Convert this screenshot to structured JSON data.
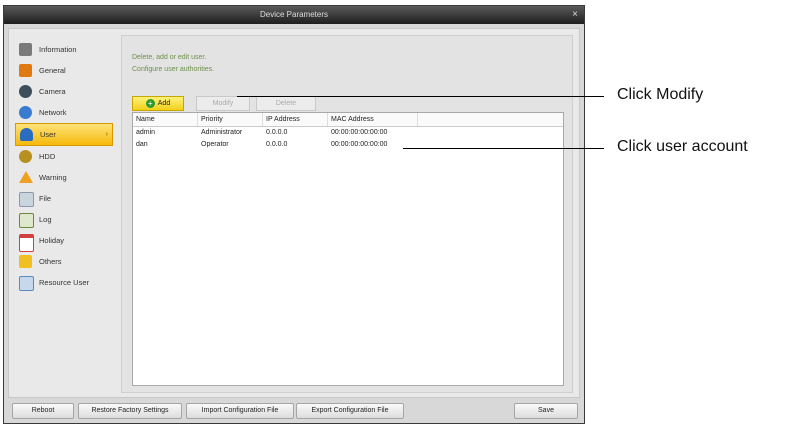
{
  "window": {
    "title": "Device Parameters",
    "close": "×"
  },
  "sidebar": {
    "items": [
      {
        "label": "Information",
        "color": "#7a7a7a"
      },
      {
        "label": "General",
        "color": "#e07a10"
      },
      {
        "label": "Camera",
        "color": "#3c4d5c"
      },
      {
        "label": "Network",
        "color": "#3a7ad0"
      },
      {
        "label": "User",
        "color": "#2a6cc0",
        "active": true
      },
      {
        "label": "HDD",
        "color": "#b89020"
      },
      {
        "label": "Warning",
        "color": "#f0a020"
      },
      {
        "label": "File",
        "color": "#8a9aaa"
      },
      {
        "label": "Log",
        "color": "#6a8a3a"
      },
      {
        "label": "Holiday",
        "color": "#d04040"
      },
      {
        "label": "Others",
        "color": "#f0c020"
      },
      {
        "label": "Resource User",
        "color": "#5a8ac0"
      }
    ],
    "active_arrow": "›"
  },
  "panel": {
    "desc_line1": "Delete, add or edit user.",
    "desc_line2": "Configure user authorities.",
    "add_label": "Add",
    "add_icon": "+",
    "modify_label": "Modify",
    "delete_label": "Delete"
  },
  "table": {
    "headers": [
      "Name",
      "Priority",
      "IP Address",
      "MAC Address"
    ],
    "rows": [
      [
        "admin",
        "Administrator",
        "0.0.0.0",
        "00:00:00:00:00:00"
      ],
      [
        "dan",
        "Operator",
        "0.0.0.0",
        "00:00:00:00:00:00"
      ]
    ]
  },
  "bottom": {
    "reboot": "Reboot",
    "restore": "Restore Factory Settings",
    "import": "Import Configuration File",
    "export": "Export Configuration File",
    "save": "Save"
  },
  "callouts": {
    "modify": "Click Modify",
    "user_account": "Click user account"
  }
}
